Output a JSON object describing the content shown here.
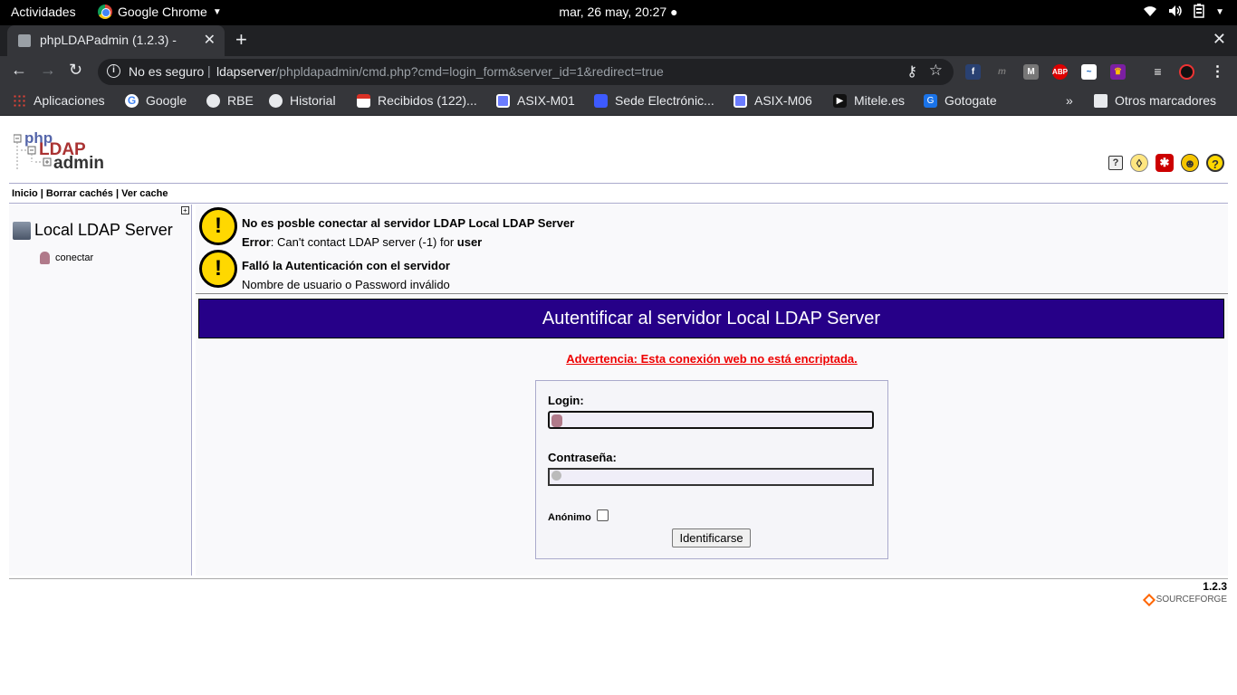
{
  "os": {
    "activities": "Actividades",
    "app_name": "Google Chrome",
    "clock": "mar, 26 may, 20:27"
  },
  "tab": {
    "title": "phpLDAPadmin (1.2.3) -",
    "close": "✕",
    "new_tab": "+"
  },
  "window": {
    "close": "✕"
  },
  "omnibox": {
    "security": "No es seguro",
    "separator": "|",
    "host": "ldapserver",
    "path": "/phpldapadmin/cmd.php?cmd=login_form&server_id=1&redirect=true"
  },
  "bookmarks": [
    {
      "label": "Aplicaciones",
      "color": "#e94235"
    },
    {
      "label": "Google",
      "color": "#4285f4"
    },
    {
      "label": "RBE",
      "color": "#e8eaed"
    },
    {
      "label": "Historial",
      "color": "#e8eaed"
    },
    {
      "label": "Recibidos (122)...",
      "color": "#d93025"
    },
    {
      "label": "ASIX-M01",
      "color": "#6b7cff"
    },
    {
      "label": "Sede Electrónic...",
      "color": "#3d5afe"
    },
    {
      "label": "ASIX-M06",
      "color": "#6b7cff"
    },
    {
      "label": "Mitele.es",
      "color": "#111111"
    },
    {
      "label": "Gotogate",
      "color": "#1a73e8"
    }
  ],
  "bookmarks_overflow": "»",
  "other_bookmarks": "Otros marcadores",
  "pla": {
    "logo_php": "php",
    "logo_ldap": "LDAP",
    "logo_admin": "admin",
    "menu": "Inicio | Borrar cachés | Ver cache",
    "tree": {
      "server_name": "Local LDAP Server",
      "connect": "conectar"
    },
    "error1": {
      "title": "No es posble conectar al servidor LDAP Local LDAP Server",
      "prefix": "Error",
      "text": ": Can't contact LDAP server (-1) for ",
      "suffix": "user"
    },
    "error2": {
      "title": "Falló la Autenticación con el servidor",
      "text": "Nombre de usuario o Password inválido"
    },
    "banner": "Autentificar al servidor Local LDAP Server",
    "warning": "Advertencia: Esta conexión web no está encriptada.",
    "login_label": "Login:",
    "password_label": "Contraseña:",
    "login_value": "",
    "password_value": "",
    "anon_label": "Anónimo",
    "submit_label": "Identificarse",
    "version": "1.2.3",
    "sourceforge": "SOURCEFORGE"
  }
}
